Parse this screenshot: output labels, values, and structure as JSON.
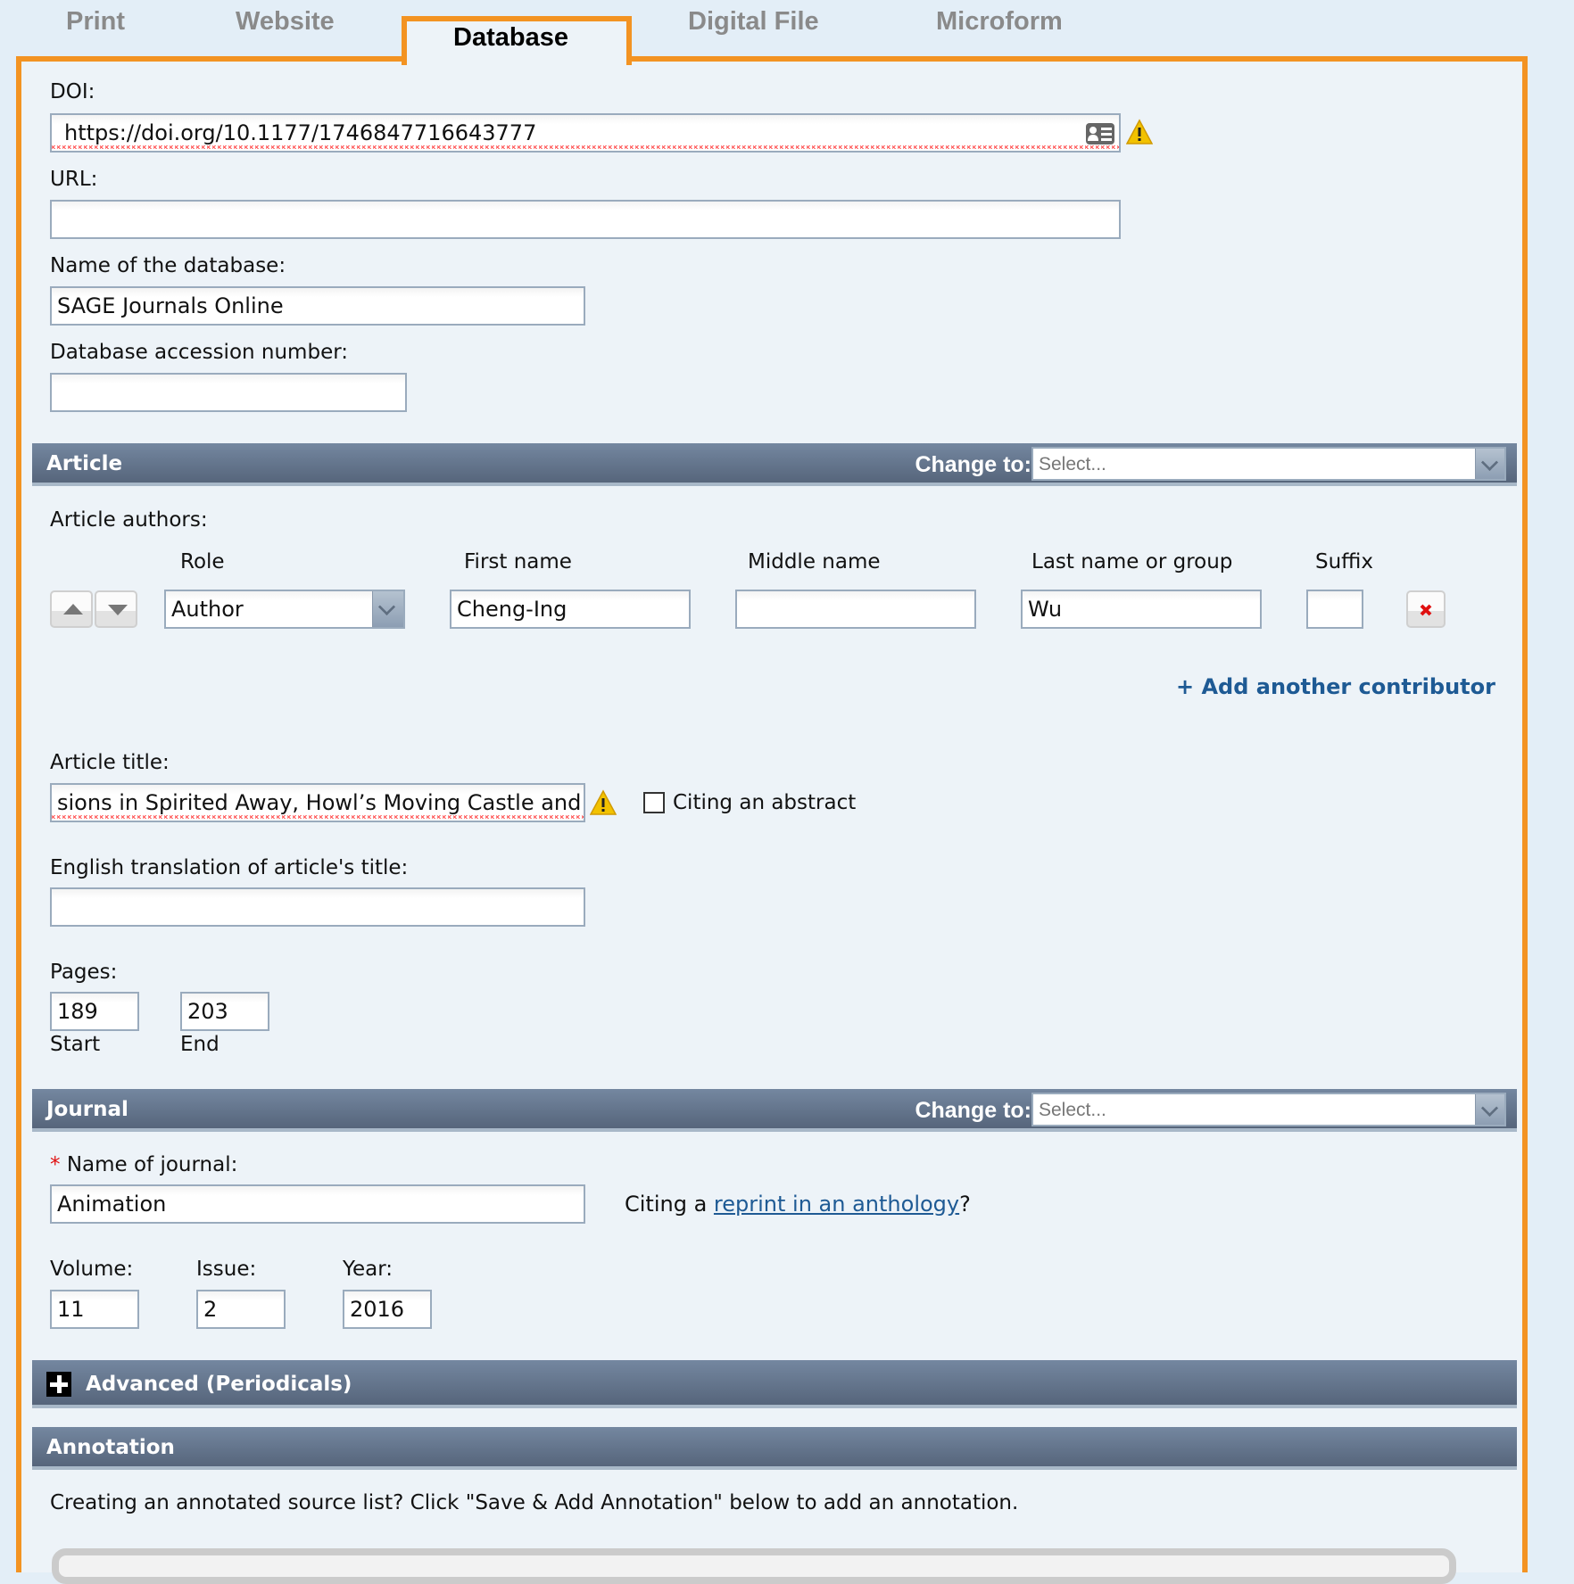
{
  "tabs": [
    {
      "label": "Print",
      "active": false
    },
    {
      "label": "Website",
      "active": false
    },
    {
      "label": "Database",
      "active": true
    },
    {
      "label": "Digital File",
      "active": false
    },
    {
      "label": "Microform",
      "active": false
    }
  ],
  "database": {
    "doi_label": "DOI:",
    "doi_value": "https://doi.org/10.1177/1746847716643777",
    "url_label": "URL:",
    "url_value": "",
    "db_name_label": "Name of the database:",
    "db_name_value": "SAGE Journals Online",
    "accession_label": "Database accession number:",
    "accession_value": ""
  },
  "article": {
    "section_title": "Article",
    "change_to_label": "Change to:",
    "change_to_placeholder": "Select...",
    "authors_label": "Article authors:",
    "columns": {
      "role": "Role",
      "first": "First name",
      "middle": "Middle name",
      "last": "Last name or group",
      "suffix": "Suffix"
    },
    "contributors": [
      {
        "role": "Author",
        "first": "Cheng-Ing",
        "middle": "",
        "last": "Wu",
        "suffix": ""
      }
    ],
    "add_contributor_label": "+ Add another contributor",
    "title_label": "Article title:",
    "title_value": "sions in Spirited Away, Howl’s Moving Castle and Ponyo",
    "citing_abstract_label": "Citing an abstract",
    "citing_abstract_checked": false,
    "translation_label": "English translation of article's title:",
    "translation_value": "",
    "pages_label": "Pages:",
    "pages_start": "189",
    "pages_end": "203",
    "start_label": "Start",
    "end_label": "End"
  },
  "journal": {
    "section_title": "Journal",
    "change_to_label": "Change to:",
    "change_to_placeholder": "Select...",
    "required_marker": "*",
    "name_label": "Name of journal:",
    "name_value": "Animation",
    "reprint_prefix": "Citing a ",
    "reprint_link": "reprint in an anthology",
    "reprint_suffix": "?",
    "volume_label": "Volume:",
    "volume_value": "11",
    "issue_label": "Issue:",
    "issue_value": "2",
    "year_label": "Year:",
    "year_value": "2016"
  },
  "advanced": {
    "title": "Advanced (Periodicals)",
    "icon": "plus-icon"
  },
  "annotation": {
    "section_title": "Annotation",
    "hint": "Creating an annotated source list? Click \"Save & Add Annotation\" below to add an annotation."
  },
  "colors": {
    "tab_border": "#f39322",
    "section_bar": "#62728a",
    "link": "#1e5a94",
    "required": "#e01010"
  }
}
